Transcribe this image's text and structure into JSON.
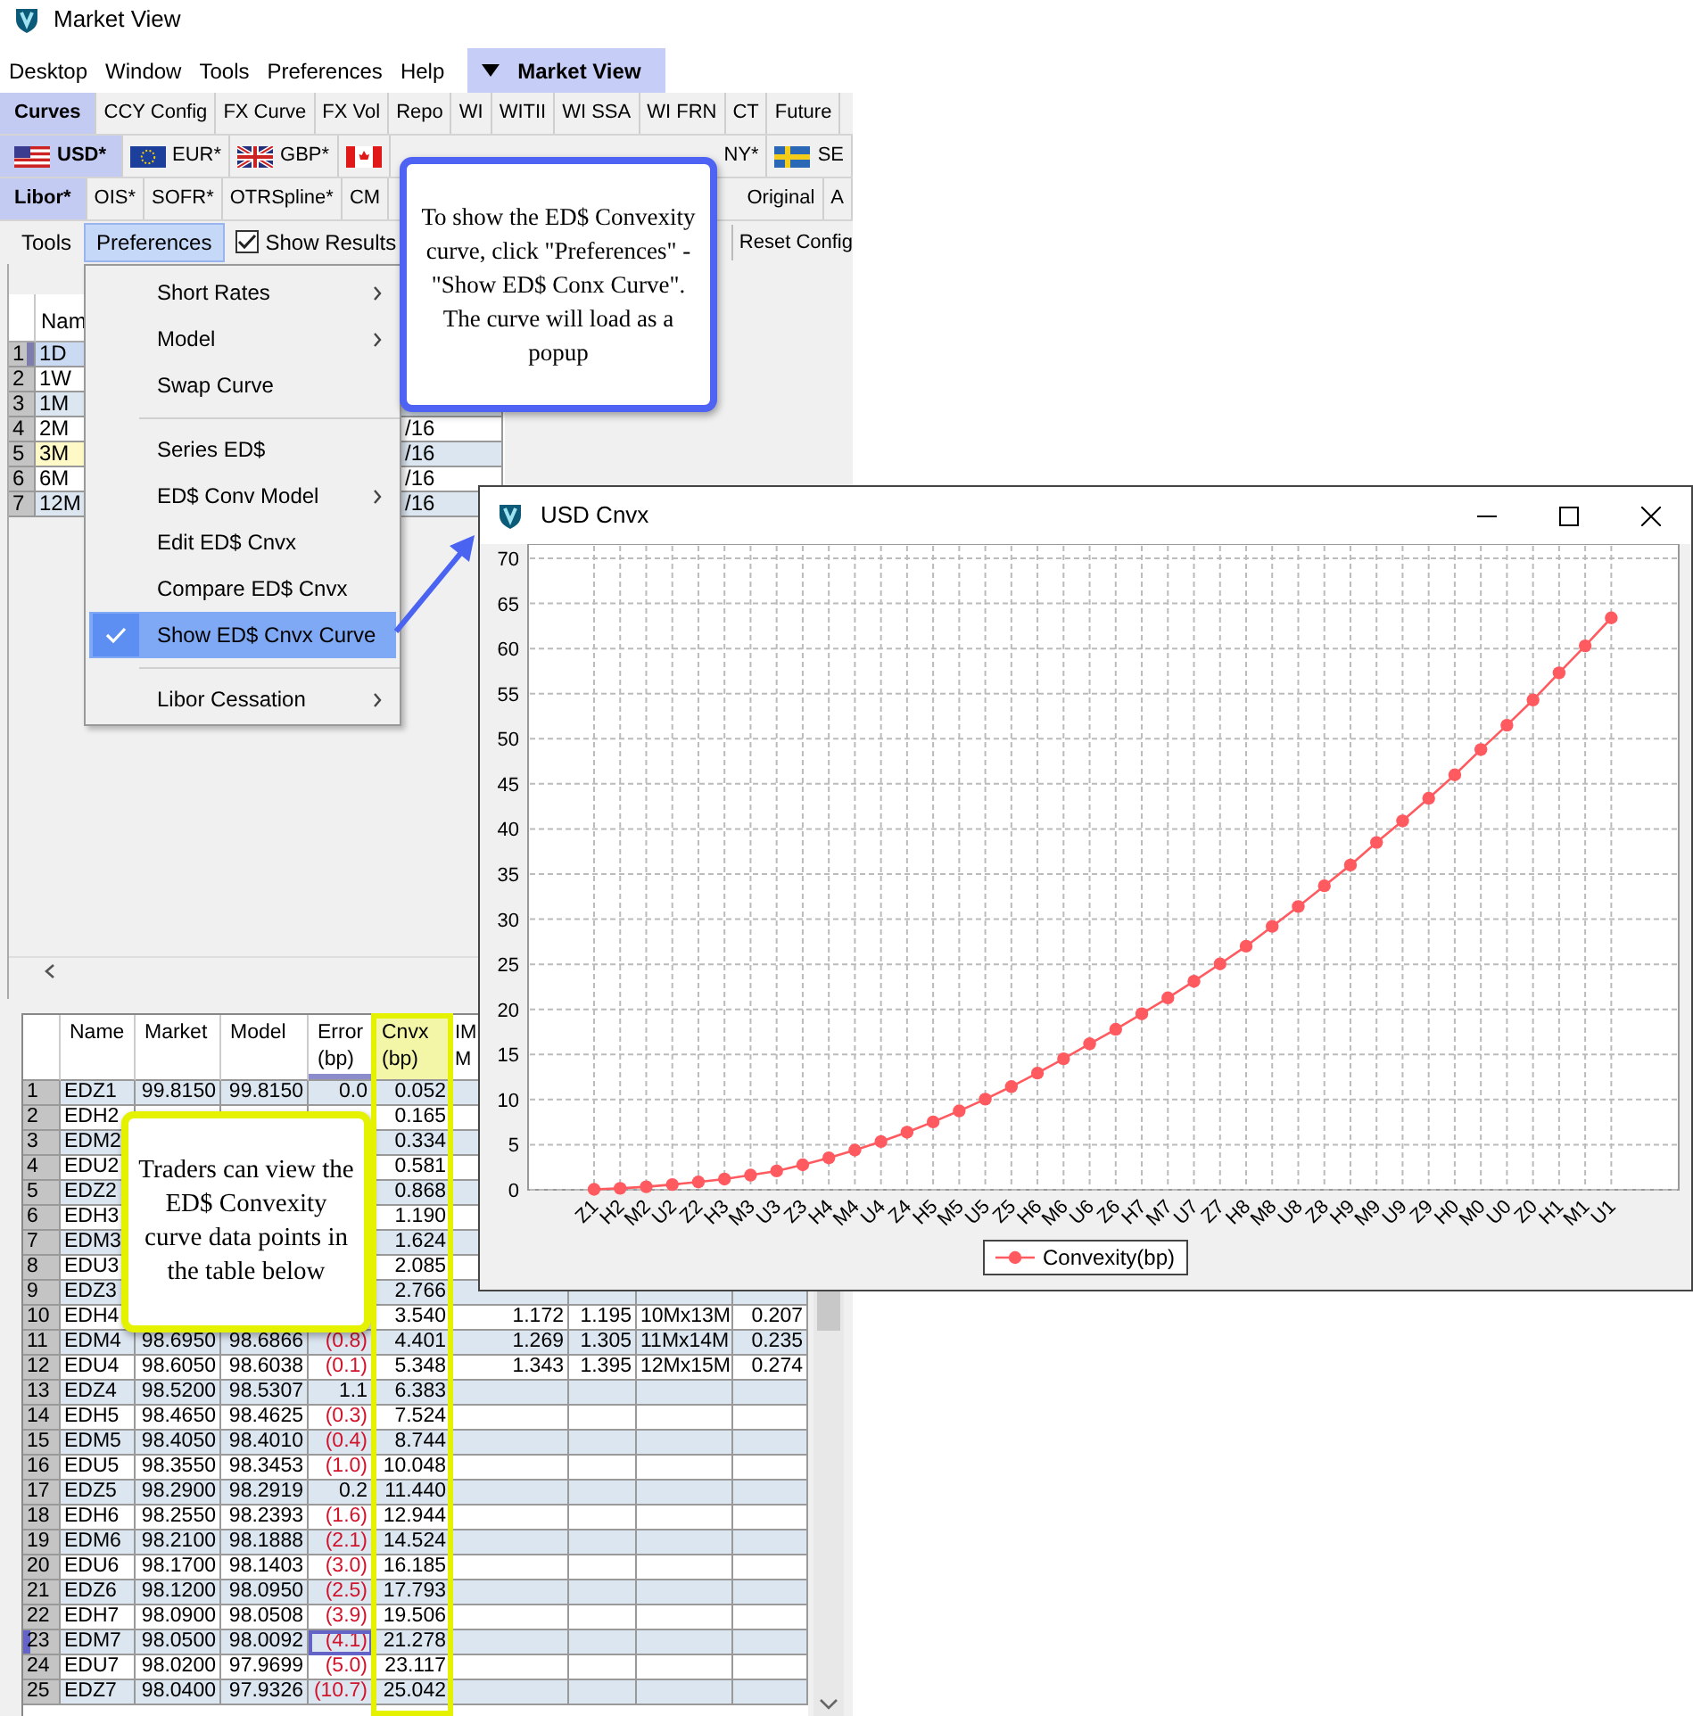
{
  "window": {
    "title": "Market View"
  },
  "menu_bar": [
    {
      "label": "Desktop",
      "kind": "menu",
      "selected": false
    },
    {
      "label": "Window",
      "kind": "menu",
      "selected": false
    },
    {
      "label": "Tools",
      "kind": "menu",
      "selected": false
    },
    {
      "label": "Preferences",
      "kind": "menu",
      "selected": false
    },
    {
      "label": "Help",
      "kind": "menu",
      "selected": false
    },
    {
      "label": "Market View",
      "kind": "dropdown",
      "selected": true
    }
  ],
  "tab_rows": [
    {
      "tabs": [
        {
          "label": "Curves",
          "selected": true
        },
        {
          "label": "CCY Config",
          "selected": false
        },
        {
          "label": "FX Curve",
          "selected": false
        },
        {
          "label": "FX Vol",
          "selected": false
        },
        {
          "label": "Repo",
          "selected": false
        },
        {
          "label": "WI",
          "selected": false
        },
        {
          "label": "WITII",
          "selected": false
        },
        {
          "label": "WI SSA",
          "selected": false
        },
        {
          "label": "WI FRN",
          "selected": false
        },
        {
          "label": "CT",
          "selected": false
        },
        {
          "label": "Future",
          "selected": false
        }
      ]
    },
    {
      "tabs": [
        {
          "label": "USD*",
          "selected": true,
          "kind": "us"
        },
        {
          "label": "EUR*",
          "selected": false,
          "kind": "eu"
        },
        {
          "label": "GBP*",
          "selected": false,
          "kind": "gb"
        },
        {
          "selected": false,
          "kind": "ca"
        }
      ],
      "trailing_tabs": [
        {
          "label": "NY*",
          "selected": false,
          "kind": "plain"
        },
        {
          "label": "SE",
          "selected": false,
          "kind": "se"
        }
      ]
    },
    {
      "tabs": [
        {
          "label": "Libor*",
          "selected": true
        },
        {
          "label": "OIS*",
          "selected": false
        },
        {
          "label": "SOFR*",
          "selected": false
        },
        {
          "label": "OTRSpline*",
          "selected": false
        },
        {
          "label": "CM",
          "selected": false
        }
      ],
      "trailing_tabs": [
        {
          "label": "Original",
          "selected": false
        },
        {
          "label": "A",
          "selected": false
        }
      ]
    }
  ],
  "toolbar": {
    "items": [
      {
        "label": "Tools",
        "selected": false
      },
      {
        "label": "Preferences",
        "selected": true
      }
    ],
    "checkbox": {
      "label": "Show Results",
      "checked": true
    },
    "trailing_button": "Reset Config"
  },
  "preferences_menu": [
    {
      "kind": "item",
      "label": "Short Rates",
      "submenu": true,
      "checked": false,
      "selected": false
    },
    {
      "kind": "item",
      "label": "Model",
      "submenu": true,
      "checked": false,
      "selected": false
    },
    {
      "kind": "item",
      "label": "Swap Curve",
      "submenu": false,
      "checked": false,
      "selected": false
    },
    {
      "kind": "separator"
    },
    {
      "kind": "item",
      "label": "Series ED$",
      "submenu": false,
      "checked": false,
      "selected": false
    },
    {
      "kind": "item",
      "label": "ED$ Conv Model",
      "submenu": true,
      "checked": false,
      "selected": false
    },
    {
      "kind": "item",
      "label": "Edit ED$ Cnvx",
      "submenu": false,
      "checked": false,
      "selected": false
    },
    {
      "kind": "item",
      "label": "Compare ED$ Cnvx",
      "submenu": false,
      "checked": false,
      "selected": false
    },
    {
      "kind": "item",
      "label": "Show ED$ Cnvx Curve",
      "submenu": false,
      "checked": true,
      "selected": true
    },
    {
      "kind": "separator"
    },
    {
      "kind": "item",
      "label": "Libor Cessation",
      "submenu": true,
      "checked": false,
      "selected": false
    }
  ],
  "tenor_table": {
    "columns": [
      "Nam"
    ],
    "rows": [
      {
        "row": "1",
        "name": "1D",
        "selected": true,
        "highlighted": false
      },
      {
        "row": "2",
        "name": "1W",
        "selected": false,
        "highlighted": false
      },
      {
        "row": "3",
        "name": "1M",
        "selected": false,
        "highlighted": false
      },
      {
        "row": "4",
        "name": "2M",
        "column_3": "/16",
        "selected": false,
        "highlighted": false
      },
      {
        "row": "5",
        "name": "3M",
        "column_3": "/16",
        "selected": false,
        "highlighted": true
      },
      {
        "row": "6",
        "name": "6M",
        "column_3": "/16",
        "selected": false,
        "highlighted": false
      },
      {
        "row": "7",
        "name": "12M",
        "column_3": "/16",
        "selected": false,
        "highlighted": false
      }
    ]
  },
  "futures_table": {
    "columns": [
      "Name",
      "Market",
      "Model",
      "Error (bp)",
      "Cnvx (bp)",
      "IM M"
    ],
    "rows": [
      {
        "row": "1",
        "name": "EDZ1",
        "market": "99.8150",
        "model": "99.8150",
        "error": "0.0",
        "error_negative": false,
        "cnvx": "0.052",
        "selected": false
      },
      {
        "row": "2",
        "name": "EDH2",
        "cnvx": "0.165",
        "selected": false
      },
      {
        "row": "3",
        "name": "EDM2",
        "cnvx": "0.334",
        "selected": false
      },
      {
        "row": "4",
        "name": "EDU2",
        "cnvx": "0.581",
        "selected": false
      },
      {
        "row": "5",
        "name": "EDZ2",
        "cnvx": "0.868",
        "selected": false
      },
      {
        "row": "6",
        "name": "EDH3",
        "cnvx": "1.190",
        "selected": false
      },
      {
        "row": "7",
        "name": "EDM3",
        "cnvx": "1.624",
        "selected": false
      },
      {
        "row": "8",
        "name": "EDU3",
        "cnvx": "2.085",
        "selected": false
      },
      {
        "row": "9",
        "name": "EDZ3",
        "cnvx": "2.766",
        "selected": false
      },
      {
        "row": "10",
        "name": "EDH4",
        "cnvx": "3.540",
        "im": "1.172",
        "column_7": "1.195",
        "column_8": "10Mx13M",
        "column_9": "0.207",
        "selected": false
      },
      {
        "row": "11",
        "name": "EDM4",
        "market": "98.6950",
        "model": "98.6866",
        "error": "(0.8)",
        "error_negative": true,
        "cnvx": "4.401",
        "im": "1.269",
        "column_7": "1.305",
        "column_8": "11Mx14M",
        "column_9": "0.235",
        "selected": false
      },
      {
        "row": "12",
        "name": "EDU4",
        "market": "98.6050",
        "model": "98.6038",
        "error": "(0.1)",
        "error_negative": true,
        "cnvx": "5.348",
        "im": "1.343",
        "column_7": "1.395",
        "column_8": "12Mx15M",
        "column_9": "0.274",
        "selected": false
      },
      {
        "row": "13",
        "name": "EDZ4",
        "market": "98.5200",
        "model": "98.5307",
        "error": "1.1",
        "error_negative": false,
        "cnvx": "6.383",
        "selected": false
      },
      {
        "row": "14",
        "name": "EDH5",
        "market": "98.4650",
        "model": "98.4625",
        "error": "(0.3)",
        "error_negative": true,
        "cnvx": "7.524",
        "selected": false
      },
      {
        "row": "15",
        "name": "EDM5",
        "market": "98.4050",
        "model": "98.4010",
        "error": "(0.4)",
        "error_negative": true,
        "cnvx": "8.744",
        "selected": false
      },
      {
        "row": "16",
        "name": "EDU5",
        "market": "98.3550",
        "model": "98.3453",
        "error": "(1.0)",
        "error_negative": true,
        "cnvx": "10.048",
        "selected": false
      },
      {
        "row": "17",
        "name": "EDZ5",
        "market": "98.2900",
        "model": "98.2919",
        "error": "0.2",
        "error_negative": false,
        "cnvx": "11.440",
        "selected": false
      },
      {
        "row": "18",
        "name": "EDH6",
        "market": "98.2550",
        "model": "98.2393",
        "error": "(1.6)",
        "error_negative": true,
        "cnvx": "12.944",
        "selected": false
      },
      {
        "row": "19",
        "name": "EDM6",
        "market": "98.2100",
        "model": "98.1888",
        "error": "(2.1)",
        "error_negative": true,
        "cnvx": "14.524",
        "selected": false
      },
      {
        "row": "20",
        "name": "EDU6",
        "market": "98.1700",
        "model": "98.1403",
        "error": "(3.0)",
        "error_negative": true,
        "cnvx": "16.185",
        "selected": false
      },
      {
        "row": "21",
        "name": "EDZ6",
        "market": "98.1200",
        "model": "98.0950",
        "error": "(2.5)",
        "error_negative": true,
        "cnvx": "17.793",
        "selected": false
      },
      {
        "row": "22",
        "name": "EDH7",
        "market": "98.0900",
        "model": "98.0508",
        "error": "(3.9)",
        "error_negative": true,
        "cnvx": "19.506",
        "selected": false
      },
      {
        "row": "23",
        "name": "EDM7",
        "market": "98.0500",
        "model": "98.0092",
        "error": "(4.1)",
        "error_negative": true,
        "cnvx": "21.278",
        "selected": true
      },
      {
        "row": "24",
        "name": "EDU7",
        "market": "98.0200",
        "model": "97.9699",
        "error": "(5.0)",
        "error_negative": true,
        "cnvx": "23.117",
        "selected": false
      },
      {
        "row": "25",
        "name": "EDZ7",
        "market": "98.0400",
        "model": "97.9326",
        "error": "(10.7)",
        "error_negative": true,
        "cnvx": "25.042",
        "selected": false
      }
    ]
  },
  "callouts": [
    {
      "kind": "blue",
      "text": "To show the ED$ Convexity curve, click \"Preferences\" - \"Show ED$ Conx Curve\". The curve will load as a popup"
    },
    {
      "kind": "yellow",
      "text": "Traders can view the ED$ Convexity curve data points in the table below"
    }
  ],
  "popup": {
    "title": "USD Cnvx",
    "chart_data": {
      "type": "line",
      "categories": [
        "Z1",
        "H2",
        "M2",
        "U2",
        "Z2",
        "H3",
        "M3",
        "U3",
        "Z3",
        "H4",
        "M4",
        "U4",
        "Z4",
        "H5",
        "M5",
        "U5",
        "Z5",
        "H6",
        "M6",
        "U6",
        "Z6",
        "H7",
        "M7",
        "U7",
        "Z7",
        "H8",
        "M8",
        "U8",
        "Z8",
        "H9",
        "M9",
        "U9",
        "Z9",
        "H0",
        "M0",
        "U0",
        "Z0",
        "H1",
        "M1",
        "U1"
      ],
      "grid": true,
      "series": [
        {
          "name": "Convexity(bp)",
          "color": "#ff5a5f",
          "marker": "circle",
          "values": [
            0.052,
            0.165,
            0.334,
            0.581,
            0.868,
            1.19,
            1.624,
            2.085,
            2.766,
            3.54,
            4.401,
            5.348,
            6.383,
            7.524,
            8.744,
            10.048,
            11.44,
            12.944,
            14.524,
            16.185,
            17.793,
            19.506,
            21.278,
            23.117,
            25.042,
            27.0,
            29.2,
            31.4,
            33.7,
            36.0,
            38.5,
            40.9,
            43.4,
            46.0,
            48.8,
            51.5,
            54.3,
            57.3,
            60.3,
            63.4
          ]
        }
      ],
      "ylim": [
        0,
        70
      ],
      "yticks": [
        0,
        5,
        10,
        15,
        20,
        25,
        30,
        35,
        40,
        45,
        50,
        55,
        60,
        65,
        70
      ]
    }
  }
}
